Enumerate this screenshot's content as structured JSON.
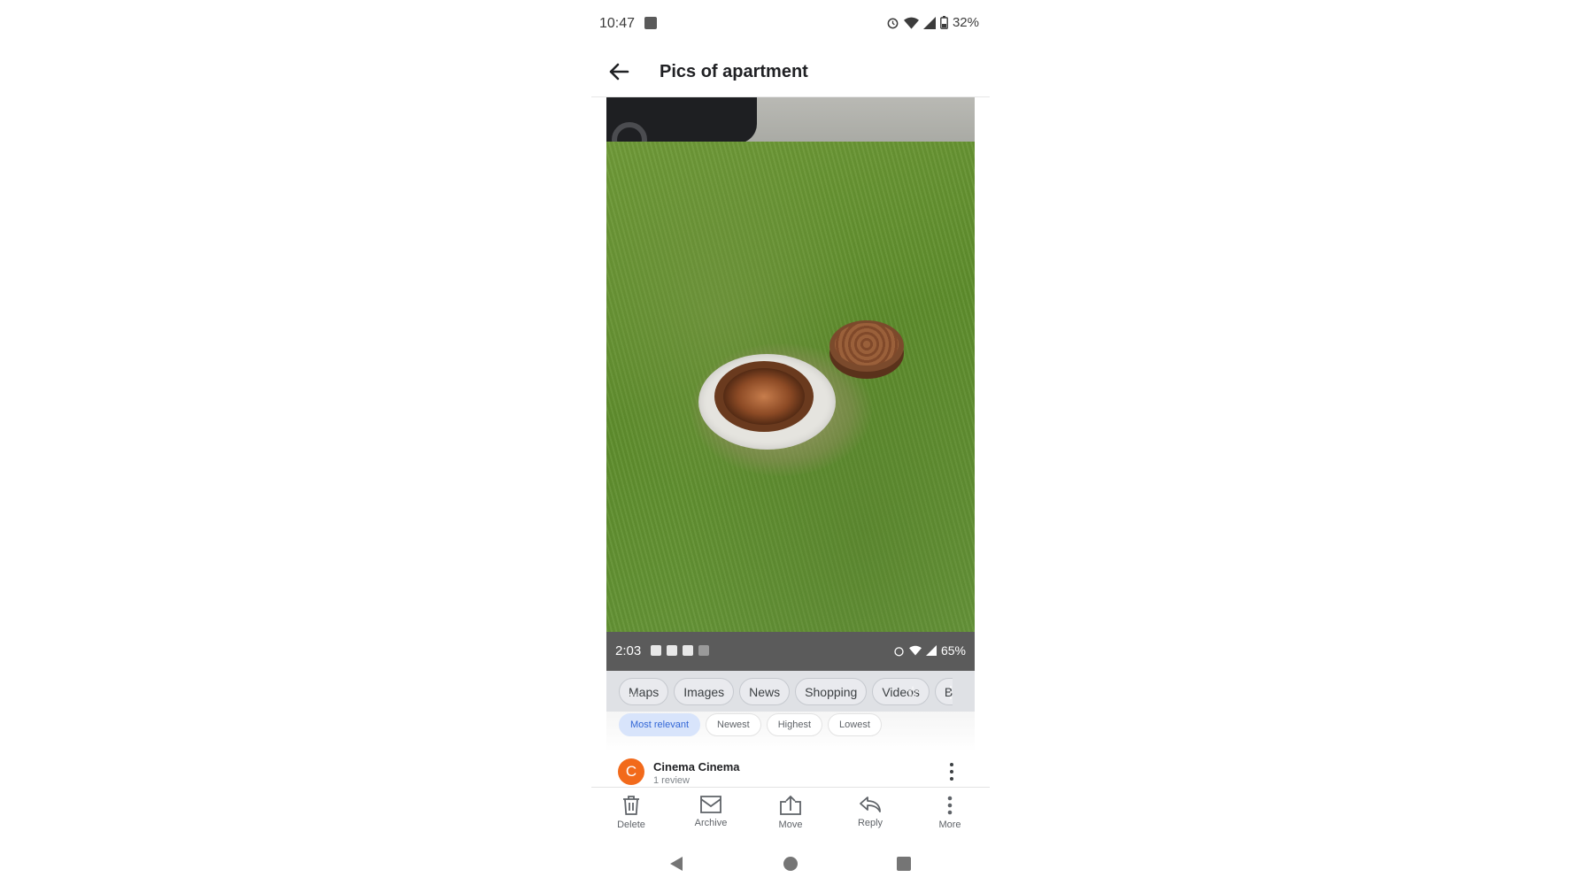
{
  "status_bar": {
    "time": "10:47",
    "battery": "32%"
  },
  "header": {
    "title": "Pics of apartment"
  },
  "attachment": {
    "inner_status": {
      "time": "2:03",
      "battery": "65%"
    },
    "search_tabs": [
      "Maps",
      "Images",
      "News",
      "Shopping",
      "Videos",
      "B"
    ],
    "sort_options": [
      "Most relevant",
      "Newest",
      "Highest",
      "Lowest"
    ],
    "sort_active": "Most relevant"
  },
  "review": {
    "avatar_letter": "C",
    "name": "Cinema Cinema",
    "subtitle": "1 review"
  },
  "actions": [
    {
      "label": "Delete",
      "icon": "trash-icon"
    },
    {
      "label": "Archive",
      "icon": "archive-icon"
    },
    {
      "label": "Move",
      "icon": "move-icon"
    },
    {
      "label": "Reply",
      "icon": "reply-icon"
    },
    {
      "label": "More",
      "icon": "more-vertical-icon"
    }
  ],
  "nav": {
    "back": "back-triangle-icon",
    "home": "home-circle-icon",
    "recents": "recents-square-icon"
  },
  "colors": {
    "avatar": "#f26a1b",
    "active_sort": "#3367d6",
    "text": "#202124"
  }
}
